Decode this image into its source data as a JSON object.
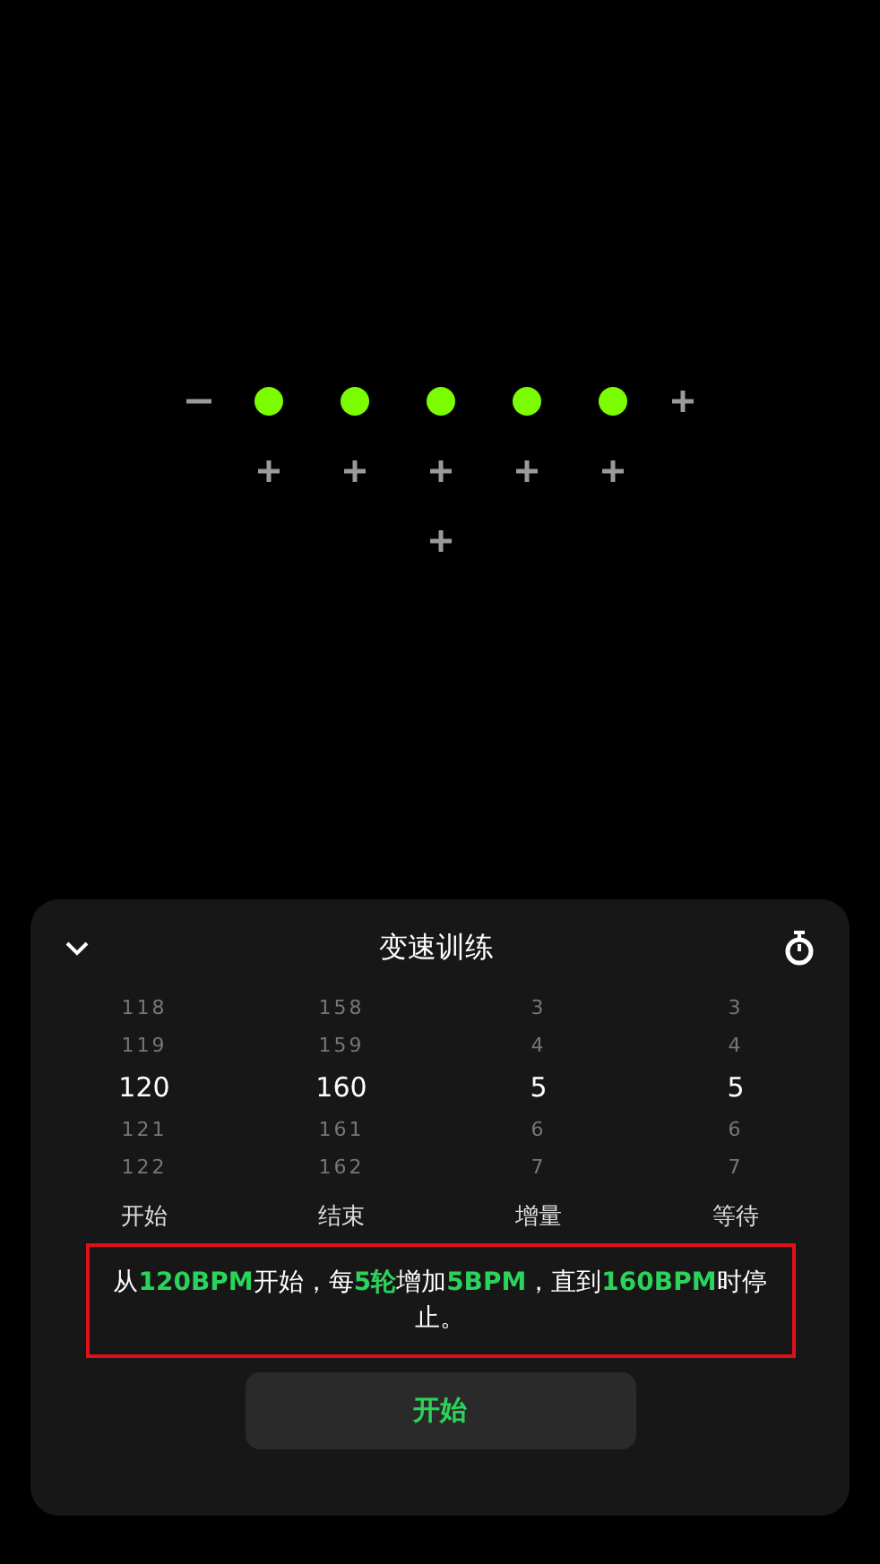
{
  "beat_grid": [
    {
      "items": [
        {
          "kind": "minus"
        },
        {
          "kind": "beat"
        },
        {
          "kind": "beat"
        },
        {
          "kind": "beat"
        },
        {
          "kind": "beat"
        },
        {
          "kind": "beat"
        },
        {
          "kind": "plus"
        }
      ]
    },
    {
      "items": [
        {
          "kind": "plus"
        },
        {
          "kind": "plus"
        },
        {
          "kind": "plus"
        },
        {
          "kind": "plus"
        },
        {
          "kind": "plus"
        }
      ]
    },
    {
      "items": [
        {
          "kind": "plus"
        }
      ]
    }
  ],
  "panel": {
    "title": "变速训练",
    "pickers": [
      {
        "label": "开始",
        "rows": [
          {
            "value": "118",
            "selected": false
          },
          {
            "value": "119",
            "selected": false
          },
          {
            "value": "120",
            "selected": true
          },
          {
            "value": "121",
            "selected": false
          },
          {
            "value": "122",
            "selected": false
          }
        ]
      },
      {
        "label": "结束",
        "rows": [
          {
            "value": "158",
            "selected": false
          },
          {
            "value": "159",
            "selected": false
          },
          {
            "value": "160",
            "selected": true
          },
          {
            "value": "161",
            "selected": false
          },
          {
            "value": "162",
            "selected": false
          }
        ]
      },
      {
        "label": "增量",
        "rows": [
          {
            "value": "3",
            "selected": false
          },
          {
            "value": "4",
            "selected": false
          },
          {
            "value": "5",
            "selected": true
          },
          {
            "value": "6",
            "selected": false
          },
          {
            "value": "7",
            "selected": false
          }
        ]
      },
      {
        "label": "等待",
        "rows": [
          {
            "value": "3",
            "selected": false
          },
          {
            "value": "4",
            "selected": false
          },
          {
            "value": "5",
            "selected": true
          },
          {
            "value": "6",
            "selected": false
          },
          {
            "value": "7",
            "selected": false
          }
        ]
      }
    ],
    "summary": "从**120BPM**开始，每**5轮**增加**5BPM**，直到**160BPM**时停止。",
    "start_button": "开始"
  }
}
